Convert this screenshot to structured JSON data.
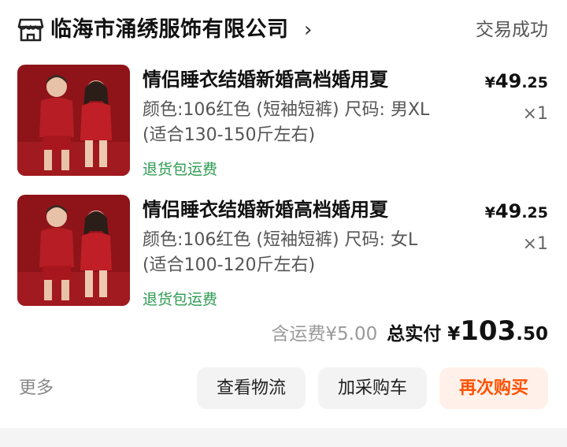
{
  "shop": {
    "name": "临海市涌绣服饰有限公司",
    "chevron": "›",
    "status": "交易成功"
  },
  "items": [
    {
      "title": "情侣睡衣结婚新婚高档婚用夏",
      "spec": "颜色:106红色 (短袖短裤) 尺码: 男XL (适合130-150斤左右)",
      "tag": "退货包运费",
      "price_currency": "¥",
      "price_int": "49",
      "price_dec": ".25",
      "qty": "×1"
    },
    {
      "title": "情侣睡衣结婚新婚高档婚用夏",
      "spec": "颜色:106红色 (短袖短裤) 尺码: 女L (适合100-120斤左右)",
      "tag": "退货包运费",
      "price_currency": "¥",
      "price_int": "49",
      "price_dec": ".25",
      "qty": "×1"
    }
  ],
  "summary": {
    "shipping": "含运费¥5.00",
    "total_label": "总实付",
    "total_currency": "¥",
    "total_int": "103",
    "total_dec": ".50"
  },
  "actions": {
    "more": "更多",
    "logistics": "查看物流",
    "add_cart": "加采购车",
    "buy_again": "再次购买"
  },
  "colors": {
    "accent": "#ff5000",
    "tag_green": "#2e9b52",
    "product_red": "#8e1419"
  }
}
